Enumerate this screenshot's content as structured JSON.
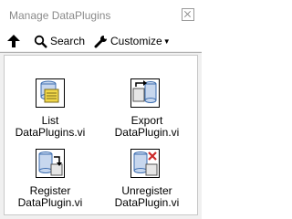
{
  "window": {
    "title": "Manage DataPlugins"
  },
  "toolbar": {
    "up_icon": "up-arrow-icon",
    "search_label": "Search",
    "customize_label": "Customize"
  },
  "items": [
    {
      "line1": "List",
      "line2": "DataPlugins.vi",
      "icon": "list-dataplugins-icon"
    },
    {
      "line1": "Export",
      "line2": "DataPlugin.vi",
      "icon": "export-dataplugin-icon"
    },
    {
      "line1": "Register",
      "line2": "DataPlugin.vi",
      "icon": "register-dataplugin-icon"
    },
    {
      "line1": "Unregister",
      "line2": "DataPlugin.vi",
      "icon": "unregister-dataplugin-icon"
    }
  ],
  "colors": {
    "title_text": "#8a8a8a",
    "cylinder_blue": "#3f6fb0",
    "cylinder_light": "#c7d7ee",
    "sheet_yellow": "#f2d84a",
    "unregister_red": "#cc2a2a"
  }
}
